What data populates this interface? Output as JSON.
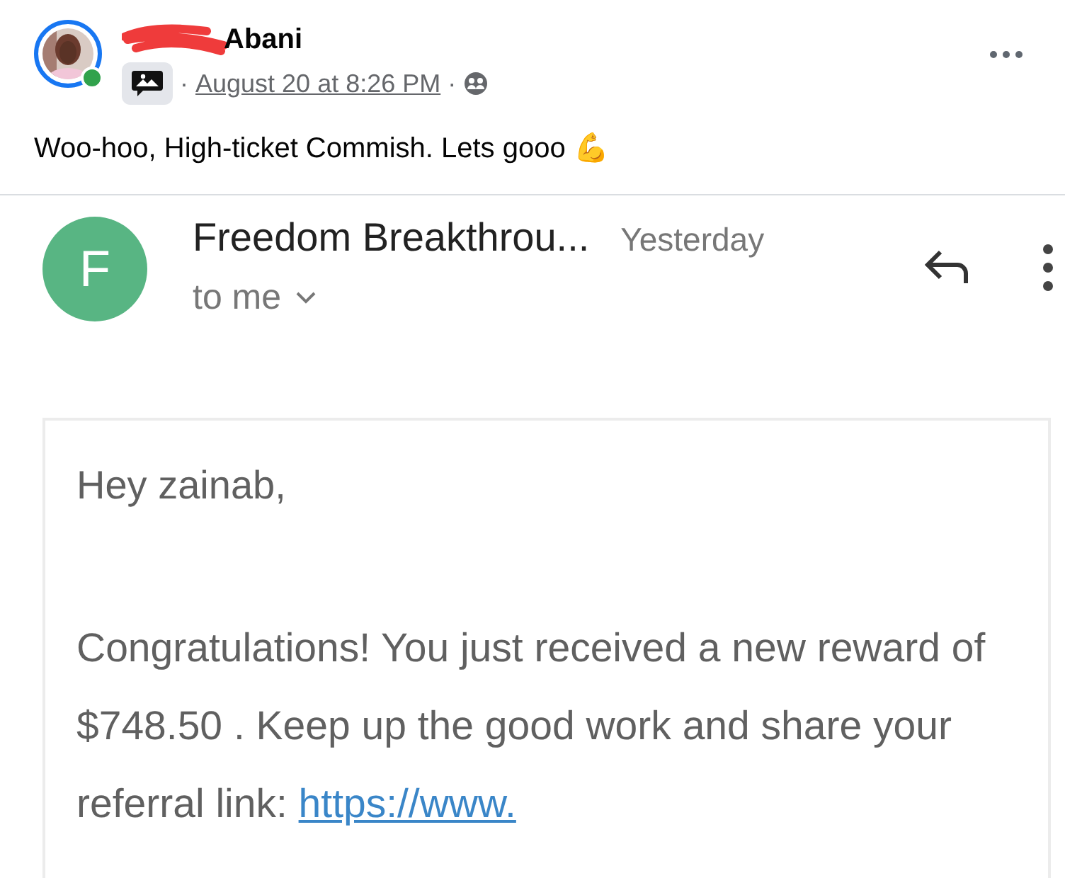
{
  "post": {
    "author_visible": "Abani",
    "author_online": true,
    "timestamp": "August 20 at 8:26 PM",
    "separator": "·",
    "text": "Woo-hoo, High-ticket Commish. Lets gooo",
    "emoji": "💪"
  },
  "email": {
    "avatar_letter": "F",
    "sender": "Freedom Breakthrou...",
    "date": "Yesterday",
    "recipient": "to me",
    "greeting": "Hey zainab,",
    "body": "Congratulations! You just received a new reward of $748.50 . Keep up the good work and share your referral link:",
    "link": "https://www."
  }
}
